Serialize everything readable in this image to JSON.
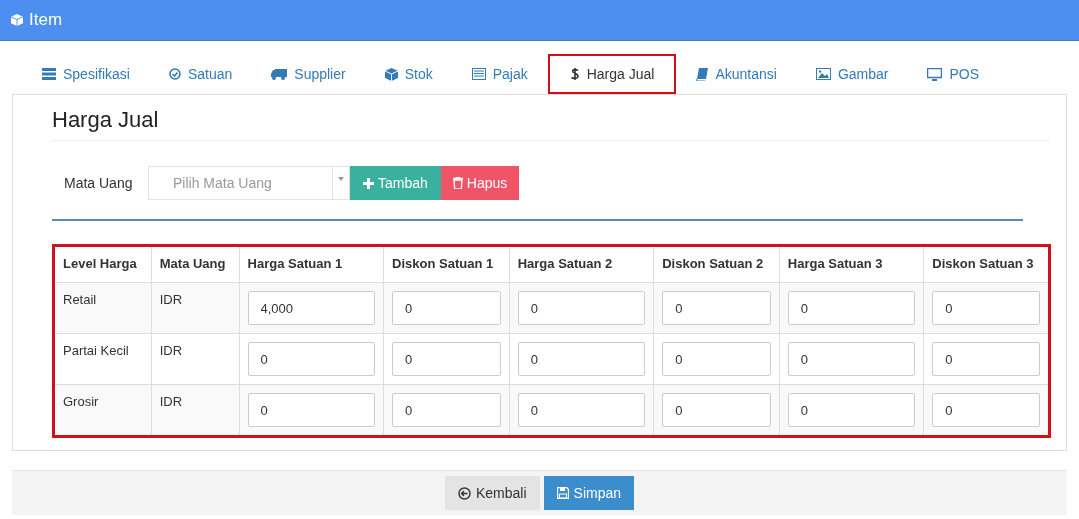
{
  "window": {
    "title": "Item"
  },
  "tabs": [
    {
      "label": "Spesifikasi",
      "selected": false
    },
    {
      "label": "Satuan",
      "selected": false
    },
    {
      "label": "Supplier",
      "selected": false
    },
    {
      "label": "Stok",
      "selected": false
    },
    {
      "label": "Pajak",
      "selected": false
    },
    {
      "label": "Harga Jual",
      "selected": true
    },
    {
      "label": "Akuntansi",
      "selected": false
    },
    {
      "label": "Gambar",
      "selected": false
    },
    {
      "label": "POS",
      "selected": false
    }
  ],
  "section_title": "Harga Jual",
  "currency_form": {
    "label": "Mata Uang",
    "placeholder": "Pilih Mata Uang",
    "buttons": [
      "Tambah",
      "Hapus"
    ]
  },
  "table": {
    "columns": [
      "Level Harga",
      "Mata Uang",
      "Harga Satuan 1",
      "Diskon Satuan 1",
      "Harga Satuan 2",
      "Diskon Satuan 2",
      "Harga Satuan 3",
      "Diskon Satuan 3"
    ],
    "rows": [
      {
        "level": "Retail",
        "currency": "IDR",
        "values": [
          "4,000",
          "0",
          "0",
          "0",
          "0",
          "0"
        ]
      },
      {
        "level": "Partai Kecil",
        "currency": "IDR",
        "values": [
          "0",
          "0",
          "0",
          "0",
          "0",
          "0"
        ]
      },
      {
        "level": "Grosir",
        "currency": "IDR",
        "values": [
          "0",
          "0",
          "0",
          "0",
          "0",
          "0"
        ]
      }
    ]
  },
  "footer_buttons": [
    "Kembali",
    "Simpan"
  ]
}
